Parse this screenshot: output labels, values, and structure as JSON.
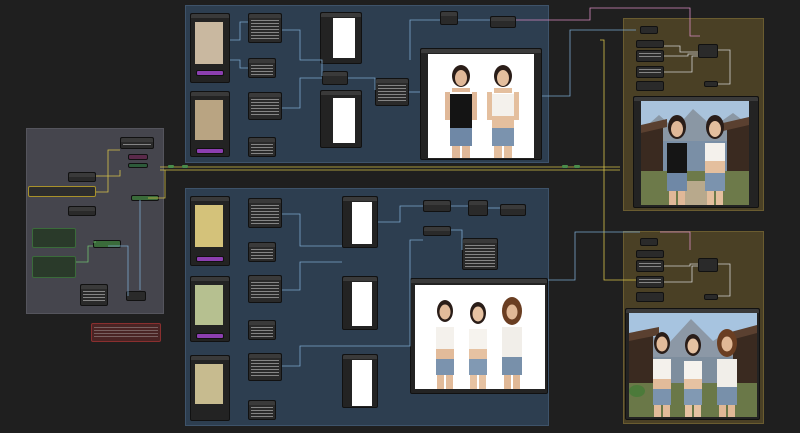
{
  "app": {
    "type": "node-graph-editor",
    "background": "#1f1f1f"
  },
  "groups": [
    {
      "id": "group-left",
      "color": "#45454d"
    },
    {
      "id": "group-top-center",
      "color": "#2d3e50"
    },
    {
      "id": "group-bottom-center",
      "color": "#2d3e50"
    },
    {
      "id": "group-top-right",
      "color": "#4a4025"
    },
    {
      "id": "group-bottom-right",
      "color": "#4a4025"
    }
  ],
  "colors": {
    "wire_yellow": "#d6c24a",
    "wire_blue": "#7aa6cc",
    "wire_pink": "#d68ac0",
    "wire_white": "#d0d0d0",
    "node_purple": "#8c3fb0",
    "node_green": "#3a6b3a",
    "node_red": "#8a2f2f"
  },
  "images": {
    "two_women_white_bg": "two-women-white-background",
    "two_women_village": "two-women-village",
    "three_women_white_bg": "three-women-white-background",
    "three_women_village": "three-women-mountain-village"
  }
}
